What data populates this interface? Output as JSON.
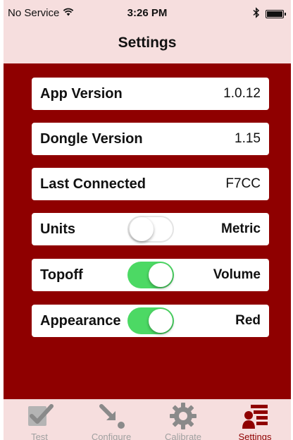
{
  "status_bar": {
    "carrier": "No Service",
    "time": "3:26 PM"
  },
  "nav": {
    "title": "Settings"
  },
  "settings": {
    "app_version": {
      "label": "App Version",
      "value": "1.0.12"
    },
    "dongle_version": {
      "label": "Dongle Version",
      "value": "1.15"
    },
    "last_connected": {
      "label": "Last Connected",
      "value": "F7CC"
    },
    "units": {
      "label": "Units",
      "value": "Metric",
      "toggle_on": false
    },
    "topoff": {
      "label": "Topoff",
      "value": "Volume",
      "toggle_on": true
    },
    "appearance": {
      "label": "Appearance",
      "value": "Red",
      "toggle_on": true
    }
  },
  "tabbar": {
    "tabs": [
      {
        "label": "Test",
        "icon": "checklist-icon",
        "active": false
      },
      {
        "label": "Configure",
        "icon": "arrow-dot-icon",
        "active": false
      },
      {
        "label": "Calibrate",
        "icon": "gear-icon",
        "active": false
      },
      {
        "label": "Settings",
        "icon": "settings-list-icon",
        "active": true
      }
    ]
  },
  "colors": {
    "brand_red": "#8f0000",
    "header_pink": "#f6dede",
    "toggle_green": "#4cd964",
    "inactive_tab": "#a0a0a0"
  }
}
